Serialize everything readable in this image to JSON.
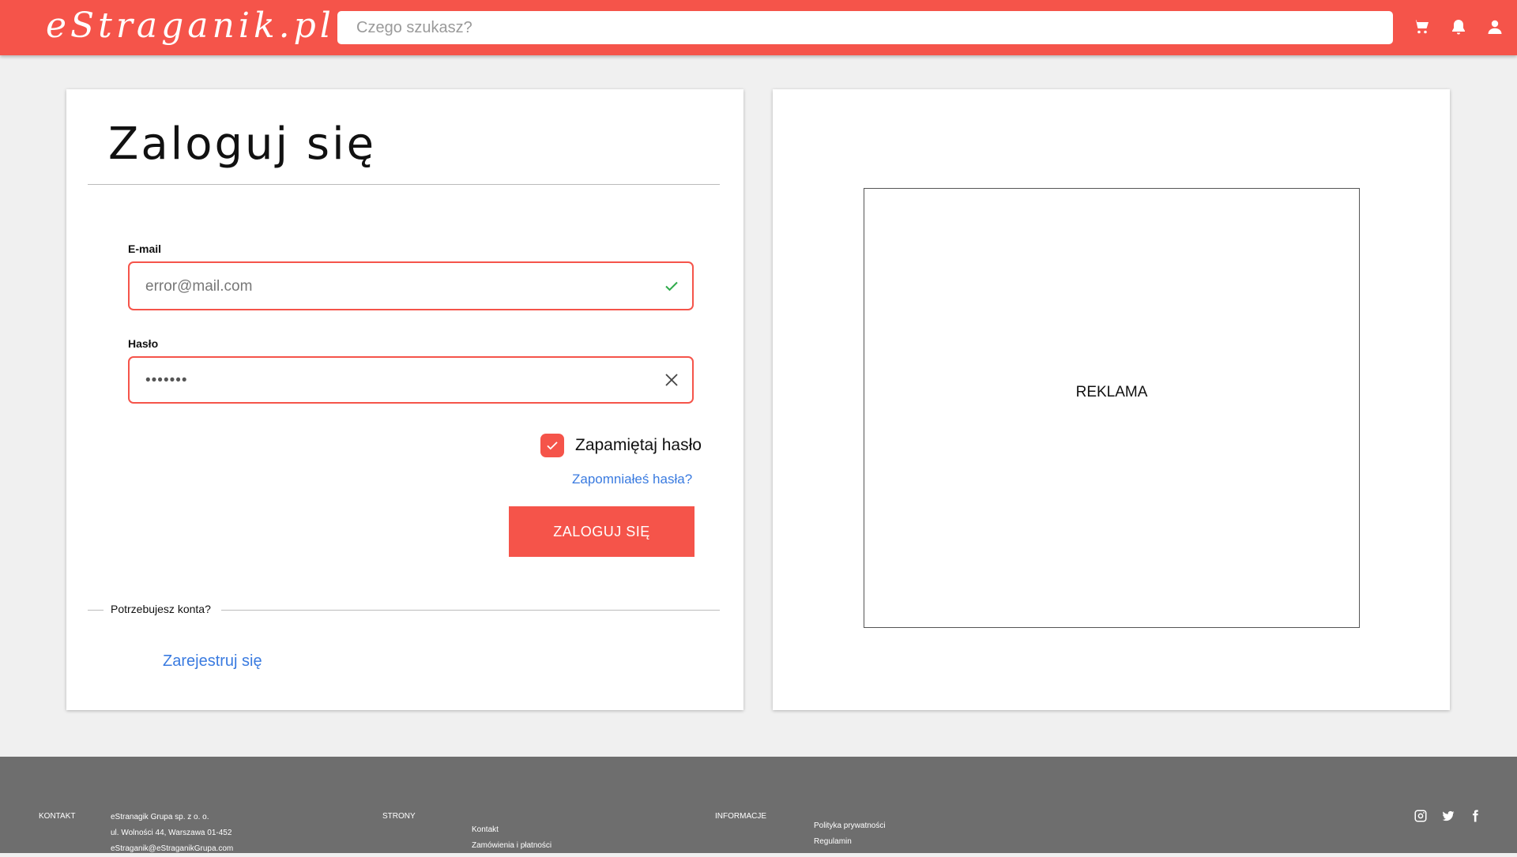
{
  "header": {
    "logo": "eStraganik.pl",
    "search_placeholder": "Czego szukasz?",
    "icons": [
      "cart-icon",
      "bell-icon",
      "user-icon"
    ]
  },
  "login": {
    "title": "Zaloguj się",
    "email_label": "E-mail",
    "email_value": "error@mail.com",
    "password_label": "Hasło",
    "password_value": "•••••••",
    "remember_label": "Zapamiętaj hasło",
    "remember_checked": true,
    "forgot_link": "Zapomniałeś hasła?",
    "submit_label": "ZALOGUJ SIĘ",
    "need_account": "Potrzebujesz konta?",
    "register_link": "Zarejestruj się"
  },
  "ad": {
    "label": "REKLAMA"
  },
  "footer": {
    "contact_heading": "KONTAKT",
    "company_name": "eStranagik Grupa sp. z o. o.",
    "address": "ul. Wolności 44, Warszawa 01-452",
    "email": "eStraganik@eStraganikGrupa.com",
    "pages_heading": "STRONY",
    "pages_links": [
      "Kontakt",
      "Zamówienia i płatności"
    ],
    "info_heading": "INFORMACJE",
    "info_links": [
      "Polityka prywatności",
      "Regulamin"
    ],
    "social_icons": [
      "instagram-icon",
      "twitter-icon",
      "facebook-icon"
    ]
  },
  "colors": {
    "accent": "#f5544a",
    "link": "#3a7be0",
    "success": "#2eaa4a",
    "footer_bg": "#6e6e6e"
  }
}
